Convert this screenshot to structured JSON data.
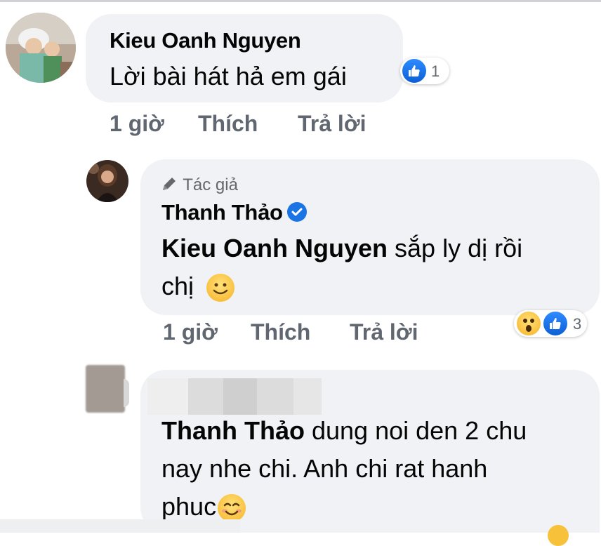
{
  "comment1": {
    "author": "Kieu Oanh Nguyen",
    "text": "Lời bài hát hả em gái",
    "reaction_count": "1",
    "time": "1 giờ",
    "like_label": "Thích",
    "reply_label": "Trả lời"
  },
  "reply1": {
    "author_badge": "Tác giả",
    "author": "Thanh Thảo",
    "mention": "Kieu Oanh Nguyen",
    "text_line1": " sắp ly dị rồi",
    "text_line2": "chị",
    "reaction_count": "3",
    "time": "1 giờ",
    "like_label": "Thích",
    "reply_label": "Trả lời"
  },
  "reply2": {
    "mention": "Thanh Thảo",
    "text_line1": " dung noi den 2 chu",
    "text_line2": "nay nhe chi. Anh chi rat hanh",
    "text_line3": "phuc"
  },
  "colors": {
    "bubble": "#f0f2f5",
    "like_blue": "#1b74e4",
    "meta_gray": "#606770"
  }
}
